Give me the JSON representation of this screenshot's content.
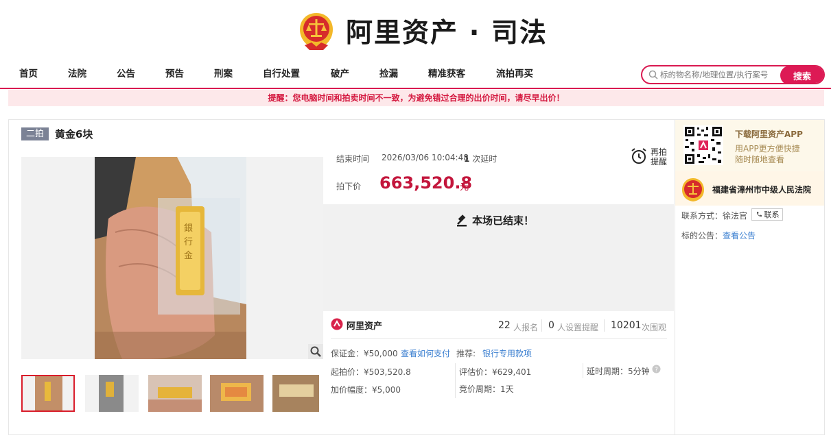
{
  "header": {
    "logo_text": "阿里资产 · 司法",
    "nav": [
      "首页",
      "法院",
      "公告",
      "预告",
      "刑案",
      "自行处置",
      "破产",
      "捡漏",
      "精准获客",
      "流拍再买"
    ],
    "search_placeholder": "标的物名称/地理位置/执行案号",
    "search_button": "搜索"
  },
  "alert": "提醒：您电脑时间和拍卖时间不一致，为避免错过合理的出价时间，请尽早出价！",
  "item": {
    "round_badge": "二拍",
    "title": "黄金6块",
    "end_label": "结束时间",
    "end_time": "2026/03/06 10:04:48",
    "delay_count": "1",
    "delay_suffix": "次延时",
    "remind_label": "再拍提醒",
    "price_label": "拍下价",
    "price_value": "663,520.8",
    "price_unit": "元",
    "ended_text": "本场已结束！"
  },
  "stats": {
    "brand": "阿里资产",
    "signups": "22",
    "signups_label": "人报名",
    "reminders": "0",
    "reminders_label": "人设置提醒",
    "views": "10201",
    "views_label": "次围观"
  },
  "details": {
    "deposit": "保证金：¥50,000",
    "how_to_pay": "查看如何支付",
    "recommend_label": "推荐:",
    "recommend_link": "银行专用款项",
    "start_price": "起拍价：¥503,520.8",
    "increment": "加价幅度：¥5,000",
    "estimate": "评估价：¥629,401",
    "bid_cycle": "竞价周期：1天",
    "delay_cycle": "延时周期：5分钟"
  },
  "sidebar": {
    "app_title": "下载阿里资产APP",
    "app_sub1": "用APP更方便快捷",
    "app_sub2": "随时随地查看",
    "court_name": "福建省漳州市中级人民法院",
    "contact_label": "联系方式：徐法官",
    "contact_button": "联系",
    "notice_label": "标的公告：",
    "notice_link": "查看公告"
  },
  "colors": {
    "brand": "#d91850",
    "price": "#c3163c",
    "link": "#3b7fd0"
  }
}
